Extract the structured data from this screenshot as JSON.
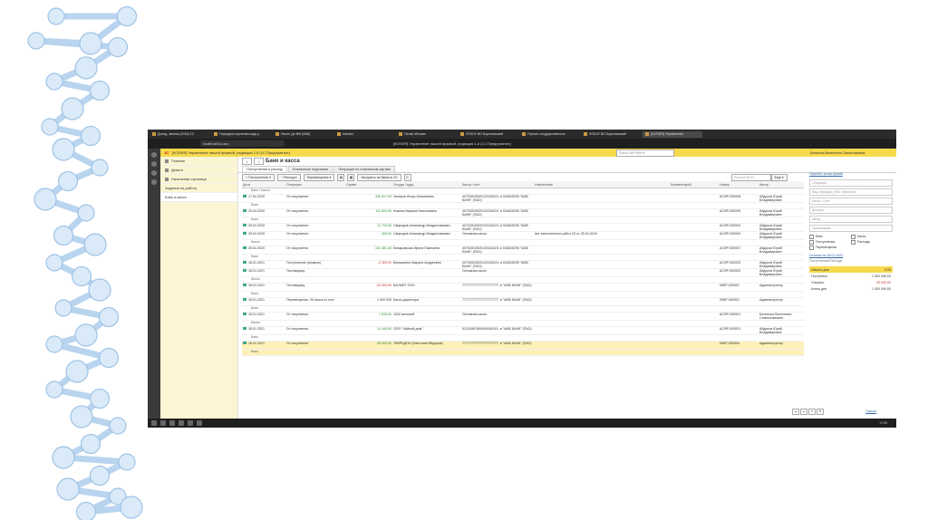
{
  "browser": {
    "tabs": [
      "Доход, звонок (2016) 1С",
      "Передача изучения кода у",
      "Иссле До ВМ (ВАК)",
      "bahaini",
      "Пензе Москва",
      "ФГБОУ ВО Воронежский",
      "Портал государственных",
      "ФГБОУ ВО Воронежский",
      "(КОПИЯ) Управление"
    ],
    "url": "localhost/1c.acc",
    "window_title": "[КОПИЯ] Управление нашей фирмой, редакция 1.6 (1С:Предприятие)"
  },
  "app": {
    "header": "[КОПИЯ] Управление нашей фирмой, редакция 1.6 (1С:Предприятие)",
    "logo": "1С",
    "search_placeholder": "Поиск Ctrl+Shift+F",
    "user": "Балиноса Валентина Станиславовна"
  },
  "sidebar": {
    "items": [
      "Главное",
      "Деньги",
      "Начальная страница",
      "Задания на работу",
      "Банк и касса"
    ]
  },
  "page": {
    "title": "Банк и касса",
    "subtabs": [
      "Поступления и расход",
      "Платежные поручения",
      "Операции по платежным картам"
    ],
    "toolbar": {
      "income": "Поступление",
      "expense": "Расход",
      "transfer": "Перемещение",
      "load": "Загрузить из банка в 1С",
      "search_placeholder": "Поиск (Ctrl+F)",
      "more": "Еще"
    },
    "columns": [
      "Дата",
      "Операция",
      "Сумма",
      "Откуда / куда",
      "Касса / счет",
      "Назначение",
      "Комментарий",
      "Номер",
      "Автор"
    ],
    "rows": [
      {
        "kind": "group",
        "label": "Банк / Касса"
      },
      {
        "date": "17.04.2020",
        "op": "От покупателя",
        "sum": "426 517,00",
        "sign": "g",
        "from": "Захаров Игорь Алексеевич",
        "acc": "40702810520120154223, в 044525290 \"АМБ БАНК\" (ПАО)",
        "purpose": "",
        "comment": "",
        "num": "АСФР-000008",
        "author": "Абдулов Юрий Владимирович"
      },
      {
        "kind": "group",
        "label": "Банк"
      },
      {
        "date": "20.04.2020",
        "op": "От покупателя",
        "sum": "112 624,00",
        "sign": "g",
        "from": "Кожина Марина Николаевна",
        "acc": "40702810520120154223, в 044525290 \"АМБ БАНК\" (ПАО)",
        "purpose": "",
        "comment": "",
        "num": "АСФР-000009",
        "author": "Абдулов Юрий Владимирович"
      },
      {
        "kind": "group",
        "label": "Банк"
      },
      {
        "date": "25.04.2020",
        "op": "От покупателя",
        "sum": "11 710,00",
        "sign": "g",
        "from": "Свиридов Александр Владиславович",
        "acc": "40702810520120154223, в 044525290 \"АМБ БАНК\" (ПАО)",
        "purpose": "",
        "comment": "",
        "num": "АСФР-000004",
        "author": "Абдулов Юрий Владимирович"
      },
      {
        "date": "25.04.2020",
        "op": "От покупателя",
        "sum": "400,00",
        "sign": "g",
        "from": "Свиридов Александр Владиславович",
        "acc": "Основная касса",
        "purpose": "Акт выполненных работ 25 от 25.04.2018",
        "comment": "",
        "num": "АСФР-000000",
        "author": "Абдулов Юрий Владимирович"
      },
      {
        "kind": "group",
        "label": "Касса"
      },
      {
        "date": "25.04.2020",
        "op": "От покупателя",
        "sum": "191 381,30",
        "sign": "g",
        "from": "Комаровская Ирина Павловна",
        "acc": "40702810520120154223, в 044525290 \"АМБ БАНК\" (ПАО)",
        "purpose": "",
        "comment": "",
        "num": "АСФР-000007",
        "author": "Абдулов Юрий Владимирович"
      },
      {
        "kind": "group",
        "label": "Банк"
      },
      {
        "date": "18.01.2021",
        "op": "Поступление (возврат)",
        "sum": "-2 300,00",
        "sign": "r",
        "from": "Вершинина Марина Андреевна",
        "acc": "40702810520120154223, в 044525290 \"АМБ БАНК\" (ПАО)",
        "purpose": "",
        "comment": "",
        "num": "АСФР-000003",
        "author": "Абдулов Юрий Владимирович"
      },
      {
        "date": "18.01.2021",
        "op": "Поставщику",
        "sum": "",
        "sign": "",
        "from": "",
        "acc": "Основная касса",
        "purpose": "",
        "comment": "",
        "num": "АСФР-000002",
        "author": "Абдулов Юрий Владимирович"
      },
      {
        "kind": "group",
        "label": "Касса"
      },
      {
        "date": "18.01.2021",
        "op": "Поставщику",
        "sum": "-30 000,00",
        "sign": "r",
        "from": "БАУМИТ ООО",
        "acc": "77777777777777777777, в \"АМБ БАНК\" (ПАО)",
        "purpose": "",
        "comment": "",
        "num": "00БР-000001",
        "author": "Администратор"
      },
      {
        "kind": "group",
        "label": "Банк"
      },
      {
        "date": "18.01.2021",
        "op": "Перемещение, 00 касса из счет",
        "sum": "1 000 000",
        "sign": "",
        "from": "Касса директора",
        "acc": "77777777777777777777, в \"АМБ БАНК\" (ПАО)",
        "purpose": "",
        "comment": "",
        "num": "00БР-000001",
        "author": "Администратор"
      },
      {
        "kind": "group",
        "label": "Банк"
      },
      {
        "date": "18.01.2021",
        "op": "От покупателя",
        "sum": "1 533,00",
        "sign": "g",
        "from": "1000 мелочей",
        "acc": "Основная касса",
        "purpose": "",
        "comment": "",
        "num": "АСФР-000001",
        "author": "Балиноса Валентина Станиславовна"
      },
      {
        "kind": "group",
        "label": "Касса"
      },
      {
        "date": "18.01.2021",
        "op": "От покупателя",
        "sum": "11 040,00",
        "sign": "g",
        "from": "ООО \"Чайный дом\"",
        "acc": "01234567890000000101, в \"АМБ БАНК\" (ПАО)",
        "purpose": "",
        "comment": "",
        "num": "АСФР-000001",
        "author": "Абдулов Юрий Владимирович"
      },
      {
        "kind": "group",
        "label": "Банк"
      },
      {
        "date": "18.01.2021",
        "op": "От покупателя",
        "sum": "30 000,00",
        "sign": "g",
        "from": "ТВЕРЬДОН (Светлана Фёдоров)",
        "acc": "77777777777777777777, в \"АМБ БАНК\" (ПАО)",
        "purpose": "",
        "comment": "",
        "num": "00БР-000004",
        "author": "Администратор",
        "hl": true
      },
      {
        "kind": "group",
        "label": "Банк",
        "hl": true
      }
    ],
    "filters": {
      "link": "Перейти за все время",
      "fields": [
        "Операция",
        "Вид операции (ИКО, аналитик)",
        "Касса / Счет",
        "Договор",
        "Автор",
        "Организация"
      ],
      "checks": [
        "Банк",
        "Касса",
        "Поступления",
        "Расходы",
        "Перемещения"
      ],
      "balance_link": "Остатки на 18.01.2021",
      "balance_sub": "Поступления/Расходы"
    },
    "balance": {
      "head_label": "Начало дня",
      "head_value": "0,00",
      "rows": [
        {
          "label": "Поступило",
          "value": "1 000 000,00"
        },
        {
          "label": "Списано",
          "value": "30 000,00",
          "red": true
        },
        {
          "label": "Конец дня",
          "value": "1 000 000,00"
        }
      ]
    },
    "bottom_link": "Скрыть"
  },
  "taskbar": {
    "clock": "17:05"
  }
}
